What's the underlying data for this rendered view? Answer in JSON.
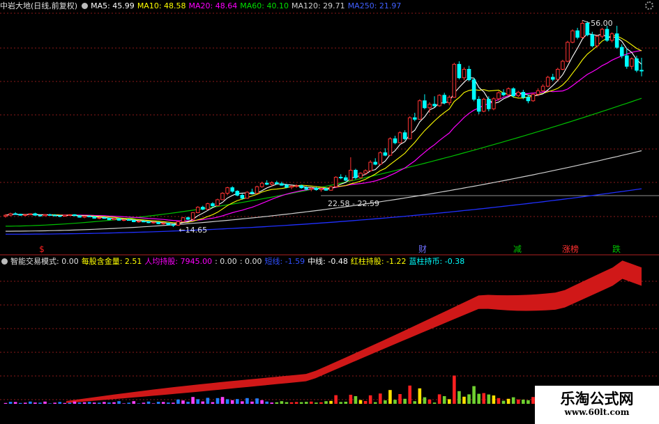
{
  "legend": {
    "title": "中岩大地(日线,前复权)",
    "ma5": "MA5: 45.99",
    "ma10": "MA10: 48.58",
    "ma20": "MA20: 48.64",
    "ma60": "MA60: 40.10",
    "ma120": "MA120: 29.71",
    "ma250": "MA250: 21.97"
  },
  "indicator_legend": {
    "name": "智能交易模式",
    "v0": ": 0.00",
    "share_label": "每股含金量: 2.51",
    "hold_label": "人均持股: 7945.00",
    "v1": ": 0.00",
    "v2": ": 0.00",
    "trend_label": "短线: -1.59",
    "mid_label": "中线: -0.48",
    "red_label": "红柱持股: -1.22",
    "blue_label": "蓝柱持币: -0.38"
  },
  "colors": {
    "ma5": "#ffffff",
    "ma10": "#ffff00",
    "ma20": "#ff00ff",
    "ma60": "#00c000",
    "ma120": "#d0d0d0",
    "ma250": "#2030ff",
    "up": "#ff3333",
    "down": "#00ffff",
    "ribbon": "#d01818",
    "grid": "#8b1a1a"
  },
  "chart_data": {
    "type": "candlestick",
    "price_axis": {
      "max_label": "56.00",
      "min_label": "14.65"
    },
    "annotations": {
      "high": "56.00",
      "low": "14.65",
      "range": "22.58 - 22.59"
    },
    "signals": [
      {
        "label": "$",
        "color": "#ff2020"
      },
      {
        "label": "财",
        "color": "#7070ff"
      },
      {
        "label": "减",
        "color": "#00c000"
      },
      {
        "label": "涨榜",
        "color": "#ff3030"
      },
      {
        "label": "跌",
        "color": "#00c000"
      }
    ],
    "candles": [
      [
        16.8,
        17.2,
        16.5,
        17.0
      ],
      [
        17.0,
        17.5,
        16.8,
        17.3
      ],
      [
        17.3,
        17.6,
        17.1,
        17.2
      ],
      [
        17.2,
        17.3,
        16.9,
        17.0
      ],
      [
        17.0,
        17.2,
        16.8,
        17.1
      ],
      [
        17.1,
        17.4,
        17.0,
        17.3
      ],
      [
        17.3,
        17.5,
        16.9,
        17.0
      ],
      [
        17.0,
        17.1,
        16.7,
        16.9
      ],
      [
        16.9,
        17.2,
        16.8,
        17.1
      ],
      [
        17.1,
        17.3,
        16.9,
        17.0
      ],
      [
        17.0,
        17.2,
        16.8,
        16.9
      ],
      [
        16.9,
        17.0,
        16.6,
        16.8
      ],
      [
        16.8,
        17.1,
        16.7,
        17.0
      ],
      [
        17.0,
        17.2,
        16.9,
        17.1
      ],
      [
        17.1,
        17.2,
        16.8,
        16.9
      ],
      [
        16.9,
        17.0,
        16.5,
        16.6
      ],
      [
        16.6,
        16.9,
        16.4,
        16.8
      ],
      [
        16.8,
        17.0,
        16.6,
        16.7
      ],
      [
        16.7,
        16.8,
        16.3,
        16.4
      ],
      [
        16.4,
        16.6,
        16.2,
        16.5
      ],
      [
        16.5,
        16.7,
        16.3,
        16.4
      ],
      [
        16.4,
        16.5,
        16.0,
        16.1
      ],
      [
        16.1,
        16.4,
        16.0,
        16.3
      ],
      [
        16.3,
        16.4,
        15.9,
        16.0
      ],
      [
        16.0,
        16.2,
        15.8,
        16.1
      ],
      [
        16.1,
        16.3,
        15.9,
        16.0
      ],
      [
        16.0,
        16.1,
        15.6,
        15.7
      ],
      [
        15.7,
        15.9,
        15.5,
        15.8
      ],
      [
        15.8,
        16.0,
        15.6,
        15.7
      ],
      [
        15.7,
        15.8,
        15.4,
        15.5
      ],
      [
        15.5,
        15.7,
        15.3,
        15.6
      ],
      [
        15.6,
        15.7,
        15.2,
        15.3
      ],
      [
        15.3,
        15.5,
        15.1,
        15.4
      ],
      [
        15.4,
        15.5,
        15.0,
        15.1
      ],
      [
        15.1,
        15.3,
        14.65,
        15.0
      ],
      [
        15.0,
        15.8,
        14.9,
        15.7
      ],
      [
        15.7,
        16.6,
        15.6,
        16.5
      ],
      [
        16.5,
        16.7,
        16.0,
        16.2
      ],
      [
        16.2,
        17.6,
        16.1,
        17.5
      ],
      [
        17.5,
        18.8,
        17.4,
        18.6
      ],
      [
        18.6,
        18.9,
        18.0,
        18.2
      ],
      [
        18.2,
        19.5,
        18.1,
        19.3
      ],
      [
        19.3,
        19.6,
        18.7,
        18.9
      ],
      [
        18.9,
        20.3,
        18.8,
        20.1
      ],
      [
        20.1,
        21.6,
        20.0,
        21.4
      ],
      [
        21.4,
        22.7,
        21.0,
        22.5
      ],
      [
        22.5,
        22.8,
        21.5,
        21.8
      ],
      [
        21.8,
        22.0,
        20.8,
        21.0
      ],
      [
        21.0,
        21.3,
        20.1,
        20.4
      ],
      [
        20.4,
        21.8,
        20.3,
        21.6
      ],
      [
        21.6,
        22.3,
        21.2,
        21.4
      ],
      [
        21.4,
        22.9,
        21.3,
        22.7
      ],
      [
        22.7,
        23.7,
        22.5,
        23.4
      ],
      [
        23.4,
        24.0,
        23.0,
        23.2
      ],
      [
        23.2,
        23.8,
        22.8,
        23.5
      ],
      [
        23.5,
        23.9,
        23.1,
        23.3
      ],
      [
        23.3,
        23.7,
        22.9,
        23.0
      ],
      [
        23.0,
        23.3,
        22.4,
        22.6
      ],
      [
        22.6,
        23.0,
        22.2,
        22.8
      ],
      [
        22.8,
        23.2,
        22.5,
        22.9
      ],
      [
        22.9,
        23.1,
        22.3,
        22.5
      ],
      [
        22.5,
        22.8,
        22.0,
        22.2
      ],
      [
        22.2,
        22.6,
        21.8,
        22.4
      ],
      [
        22.4,
        22.7,
        21.9,
        22.1
      ],
      [
        22.1,
        22.5,
        21.7,
        22.3
      ],
      [
        22.3,
        22.6,
        21.9,
        22.0
      ],
      [
        22.0,
        22.9,
        21.9,
        22.7
      ],
      [
        22.7,
        24.8,
        22.6,
        24.6
      ],
      [
        24.6,
        25.2,
        24.2,
        24.5
      ],
      [
        24.5,
        25.0,
        23.8,
        24.0
      ],
      [
        24.0,
        28.6,
        23.9,
        26.0
      ],
      [
        26.0,
        26.3,
        24.2,
        24.5
      ],
      [
        24.5,
        25.6,
        24.3,
        25.4
      ],
      [
        25.4,
        26.2,
        25.1,
        25.9
      ],
      [
        25.9,
        28.0,
        25.7,
        27.6
      ],
      [
        27.6,
        28.4,
        27.0,
        27.2
      ],
      [
        27.2,
        29.8,
        27.1,
        29.5
      ],
      [
        29.5,
        30.4,
        28.8,
        29.0
      ],
      [
        29.0,
        32.6,
        28.9,
        32.3
      ],
      [
        32.3,
        32.9,
        31.2,
        31.5
      ],
      [
        31.5,
        33.8,
        31.4,
        33.5
      ],
      [
        33.5,
        34.0,
        32.0,
        32.3
      ],
      [
        32.3,
        36.8,
        32.2,
        36.5
      ],
      [
        36.5,
        37.5,
        35.8,
        36.2
      ],
      [
        36.2,
        40.2,
        36.1,
        39.9
      ],
      [
        39.9,
        41.2,
        38.2,
        38.5
      ],
      [
        38.5,
        39.6,
        37.5,
        39.2
      ],
      [
        39.2,
        40.8,
        38.6,
        38.9
      ],
      [
        38.9,
        41.2,
        38.7,
        41.0
      ],
      [
        41.0,
        41.5,
        39.2,
        39.5
      ],
      [
        39.5,
        41.0,
        39.0,
        40.6
      ],
      [
        40.6,
        47.5,
        40.5,
        47.2
      ],
      [
        47.2,
        47.8,
        44.2,
        44.5
      ],
      [
        44.5,
        46.6,
        44.0,
        46.2
      ],
      [
        46.2,
        46.9,
        43.8,
        44.1
      ],
      [
        44.1,
        44.5,
        39.8,
        40.2
      ],
      [
        40.2,
        40.8,
        37.2,
        37.8
      ],
      [
        37.8,
        40.5,
        37.6,
        40.2
      ],
      [
        40.2,
        40.8,
        37.8,
        38.3
      ],
      [
        38.3,
        40.6,
        38.0,
        40.3
      ],
      [
        40.3,
        41.8,
        39.9,
        41.5
      ],
      [
        41.5,
        42.2,
        40.8,
        41.1
      ],
      [
        41.1,
        42.6,
        40.9,
        42.3
      ],
      [
        42.3,
        42.6,
        40.5,
        40.9
      ],
      [
        40.9,
        41.9,
        40.6,
        41.6
      ],
      [
        41.6,
        42.1,
        40.2,
        40.6
      ],
      [
        40.6,
        41.1,
        39.4,
        39.9
      ],
      [
        39.9,
        41.5,
        39.7,
        41.2
      ],
      [
        41.2,
        42.4,
        40.8,
        41.9
      ],
      [
        41.9,
        43.2,
        41.7,
        42.8
      ],
      [
        42.8,
        44.9,
        42.6,
        44.6
      ],
      [
        44.6,
        45.3,
        43.8,
        44.2
      ],
      [
        44.2,
        46.5,
        44.0,
        46.2
      ],
      [
        46.2,
        48.1,
        46.0,
        47.8
      ],
      [
        47.8,
        51.9,
        47.6,
        51.6
      ],
      [
        51.6,
        54.2,
        51.4,
        53.9
      ],
      [
        53.9,
        54.5,
        52.2,
        52.6
      ],
      [
        52.6,
        56.0,
        52.4,
        55.4
      ],
      [
        55.4,
        55.8,
        52.8,
        53.1
      ],
      [
        53.1,
        53.7,
        50.6,
        50.9
      ],
      [
        50.9,
        53.1,
        50.6,
        52.8
      ],
      [
        52.8,
        54.5,
        52.4,
        54.2
      ],
      [
        54.2,
        54.9,
        51.7,
        52.0
      ],
      [
        52.0,
        53.6,
        51.6,
        53.3
      ],
      [
        53.3,
        54.9,
        50.3,
        50.6
      ],
      [
        50.6,
        51.2,
        48.4,
        48.9
      ],
      [
        48.9,
        50.4,
        46.3,
        46.8
      ],
      [
        46.8,
        48.6,
        46.2,
        48.3
      ],
      [
        48.3,
        48.9,
        45.6,
        46.0
      ],
      [
        46.0,
        48.5,
        44.8,
        45.99
      ]
    ]
  }
}
